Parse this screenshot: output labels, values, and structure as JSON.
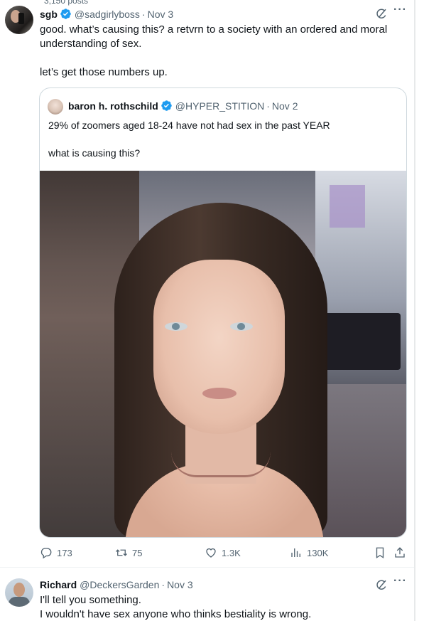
{
  "top_fragment": "3,150 posts",
  "tweet": {
    "author": {
      "name": "sgb",
      "handle": "@sadgirlyboss",
      "date": "Nov 3",
      "verified": true
    },
    "text_line1": "good. what’s causing this? a retvrn to a society with an ordered and moral",
    "text_line2": "understanding of sex.",
    "text_line3": "let’s get those numbers up.",
    "quote": {
      "author": {
        "name": "baron h. rothschild",
        "handle": "@HYPER_STITION",
        "date": "Nov 2",
        "verified": true
      },
      "text_line1": "29% of zoomers aged 18-24 have not had sex in the past YEAR",
      "text_line2": "what is causing this?",
      "image": "portrait-photo"
    },
    "actions": {
      "replies": "173",
      "reposts": "75",
      "likes": "1.3K",
      "views": "130K"
    }
  },
  "reply": {
    "author": {
      "name": "Richard",
      "handle": "@DeckersGarden",
      "date": "Nov 3"
    },
    "text_line1": "I'll tell you something.",
    "text_line2": "I wouldn't have sex anyone who thinks bestiality is wrong."
  },
  "icons": {
    "verified": "verified-badge-icon",
    "grok": "grok-icon",
    "more": "more-icon",
    "reply": "reply-icon",
    "repost": "repost-icon",
    "like": "like-icon",
    "views": "views-icon",
    "bookmark": "bookmark-icon",
    "share": "share-icon"
  },
  "colors": {
    "verified": "#1d9bf0",
    "muted": "#536471",
    "text": "#0f1419",
    "border": "#cfd9de"
  }
}
